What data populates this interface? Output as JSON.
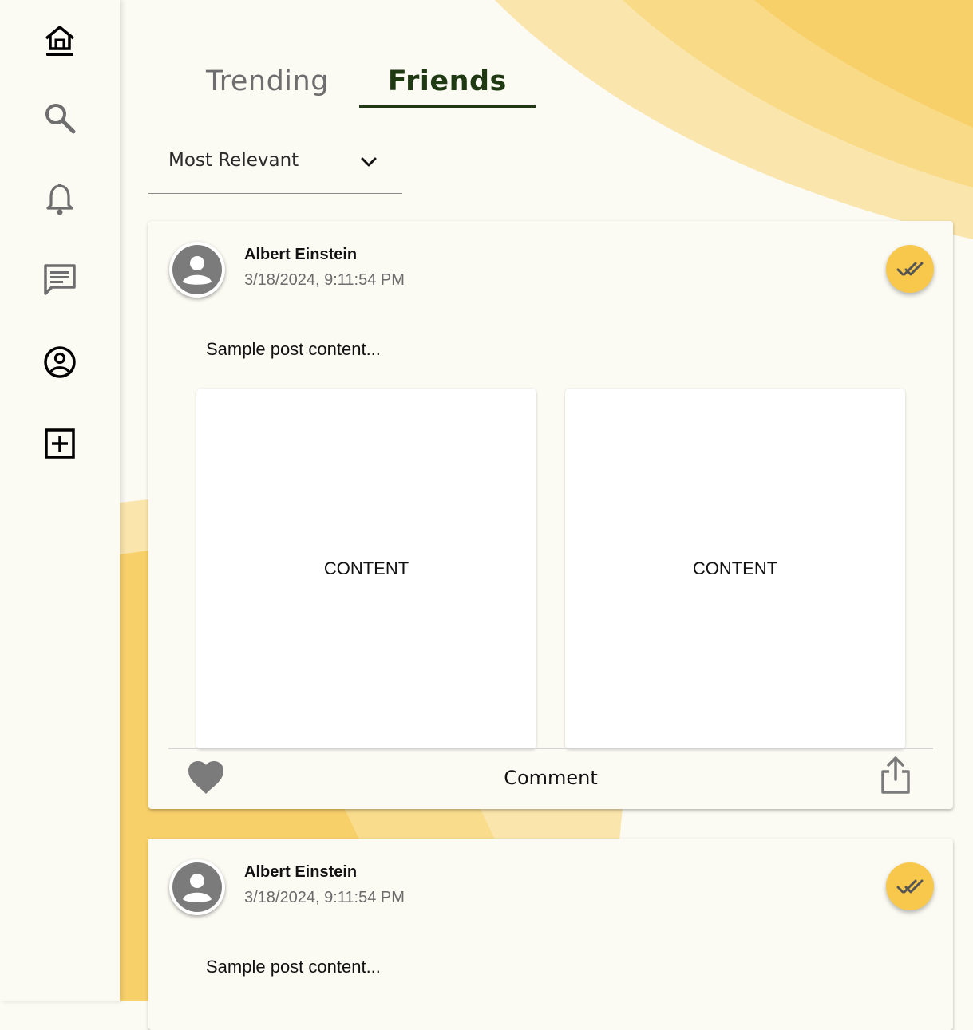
{
  "nav": {
    "items": [
      {
        "name": "home-icon"
      },
      {
        "name": "search-icon"
      },
      {
        "name": "bell-icon"
      },
      {
        "name": "chat-icon"
      },
      {
        "name": "profile-icon"
      },
      {
        "name": "add-post-icon"
      }
    ]
  },
  "tabs": {
    "trending": "Trending",
    "friends": "Friends",
    "active": "Friends"
  },
  "sort": {
    "selected": "Most Relevant"
  },
  "posts": [
    {
      "author": "Albert Einstein",
      "timestamp": "3/18/2024, 9:11:54 PM",
      "text": "Sample post content...",
      "media": [
        "CONTENT",
        "CONTENT"
      ],
      "comment_label": "Comment"
    },
    {
      "author": "Albert Einstein",
      "timestamp": "3/18/2024, 9:11:54 PM",
      "text": "Sample post content..."
    }
  ],
  "colors": {
    "background": "#fbfaf3",
    "accent_yellow": "#f8c84d",
    "accent_green": "#1f3a12",
    "icon_gray": "#777777"
  }
}
